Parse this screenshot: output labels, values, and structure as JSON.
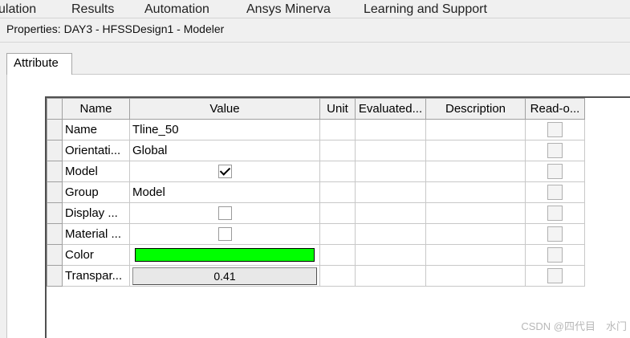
{
  "menubar": {
    "items": [
      "ulation",
      "Results",
      "Automation",
      "Ansys Minerva",
      "Learning and Support"
    ]
  },
  "properties_title": "Properties: DAY3 - HFSSDesign1 - Modeler",
  "tabs": [
    {
      "label": "Attribute",
      "active": true
    }
  ],
  "grid": {
    "headers": {
      "name": "Name",
      "value": "Value",
      "unit": "Unit",
      "evaluated": "Evaluated...",
      "description": "Description",
      "readonly": "Read-o..."
    },
    "rows": [
      {
        "name": "Name",
        "value": "Tline_50",
        "type": "text",
        "readonly_checked": false
      },
      {
        "name": "Orientati...",
        "value": "Global",
        "type": "text",
        "readonly_checked": false
      },
      {
        "name": "Model",
        "type": "checkbox",
        "checked": true,
        "readonly_checked": false
      },
      {
        "name": "Group",
        "value": "Model",
        "type": "text",
        "readonly_checked": false
      },
      {
        "name": "Display ...",
        "type": "checkbox",
        "checked": false,
        "readonly_checked": false
      },
      {
        "name": "Material ...",
        "type": "checkbox",
        "checked": false,
        "readonly_checked": false
      },
      {
        "name": "Color",
        "type": "color",
        "color": "#00ff00",
        "readonly_checked": false
      },
      {
        "name": "Transpar...",
        "type": "button",
        "value": "0.41",
        "readonly_checked": false
      }
    ]
  },
  "watermark": "CSDN @四代目　水门"
}
